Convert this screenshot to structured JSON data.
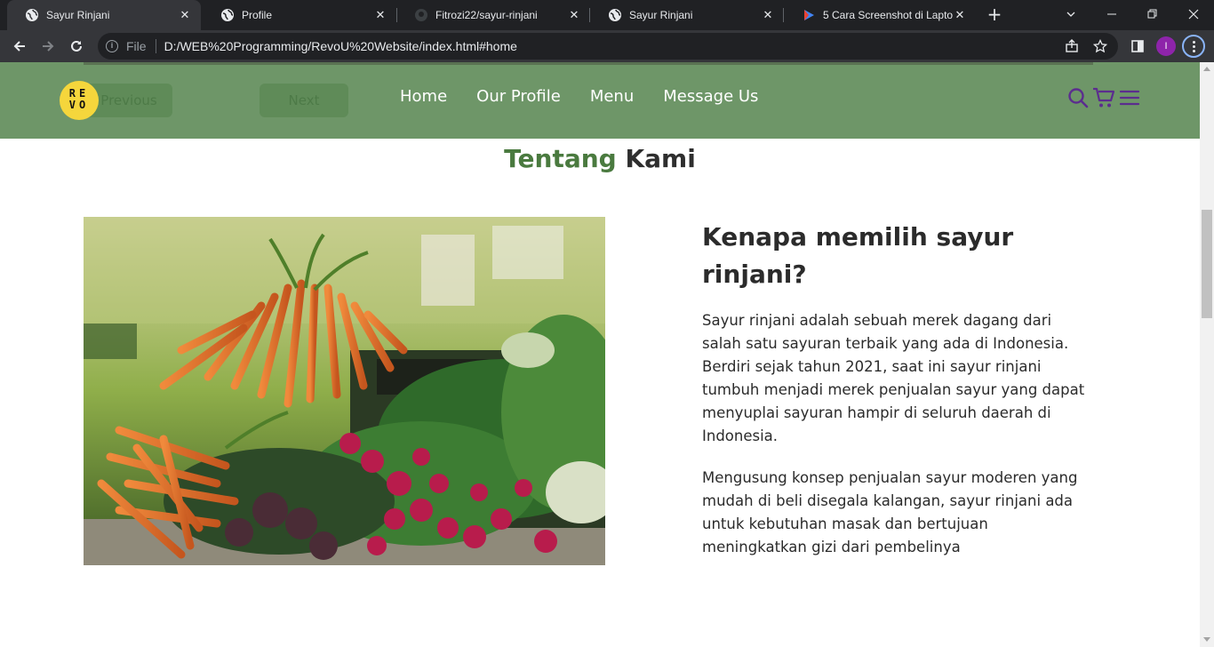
{
  "browser": {
    "tabs": [
      {
        "title": "Sayur Rinjani",
        "favicon": "globe-icon",
        "active": true
      },
      {
        "title": "Profile",
        "favicon": "globe-icon",
        "active": false
      },
      {
        "title": "Fitrozi22/sayur-rinjani",
        "favicon": "github-icon",
        "active": false
      },
      {
        "title": "Sayur Rinjani",
        "favicon": "globe-icon",
        "active": false
      },
      {
        "title": "5 Cara Screenshot di Laptop",
        "favicon": "play-icon",
        "active": false
      }
    ],
    "address": {
      "scheme_label": "File",
      "url": "D:/WEB%20Programming/RevoU%20Website/index.html#home"
    },
    "profile_initial": "I"
  },
  "site": {
    "logo_text": "RE VO",
    "slider_buttons": {
      "previous": "Previous",
      "next": "Next"
    },
    "nav": [
      {
        "label": "Home"
      },
      {
        "label": "Our Profile"
      },
      {
        "label": "Menu"
      },
      {
        "label": "Message Us"
      }
    ],
    "nav_icons": [
      "search-icon",
      "cart-icon",
      "menu-icon"
    ],
    "colors": {
      "navbar": "#6e9668",
      "accent": "#4a7a3f",
      "logo": "#f5d63c",
      "icon": "#5b2d8e"
    },
    "about": {
      "title_accent": "Tentang",
      "title_rest": "Kami",
      "heading": "Kenapa memilih sayur rinjani?",
      "paragraph_1": "Sayur rinjani adalah sebuah merek dagang dari salah satu sayuran terbaik yang ada di Indonesia. Berdiri sejak tahun 2021, saat ini sayur rinjani tumbuh menjadi merek penjualan sayur yang dapat menyuplai sayuran hampir di seluruh daerah di Indonesia.",
      "paragraph_2": "Mengusung konsep penjualan sayur moderen yang mudah di beli disegala kalangan, sayur rinjani ada untuk kebutuhan masak dan bertujuan meningkatkan gizi dari pembelinya"
    }
  }
}
